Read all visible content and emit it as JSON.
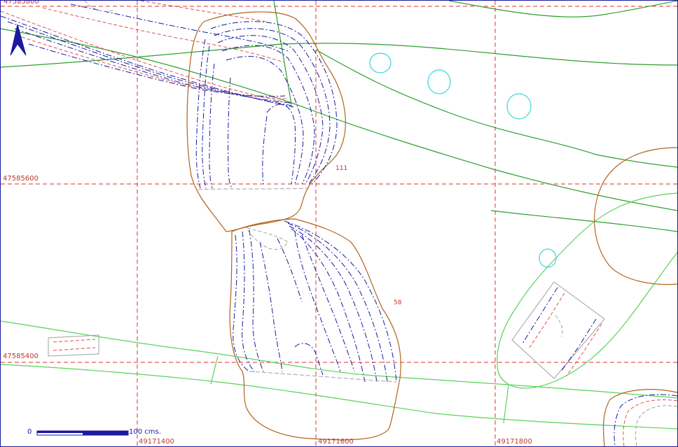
{
  "map": {
    "grid": {
      "easting_labels": [
        "49171400",
        "49171600",
        "49171800"
      ],
      "northing_labels": [
        "47585600",
        "47585400"
      ],
      "top_partial_label": "47585800"
    },
    "features": [
      {
        "id": "111",
        "label": "111"
      },
      {
        "id": "58",
        "label": "58"
      }
    ],
    "scale_bar": {
      "start_label": "0",
      "end_label": "100",
      "unit": "cms."
    },
    "north_arrow": {
      "icon": "north-arrow-icon"
    },
    "colors": {
      "grid": "#e0302a",
      "contour": "#1a1aa0",
      "contour_red": "#e05050",
      "feature_outline": "#b0641e",
      "green_line": "#2e9e2e",
      "light_green_line": "#5ad25a",
      "cyan": "#39d6dc",
      "grey": "#a0a0a0"
    }
  }
}
